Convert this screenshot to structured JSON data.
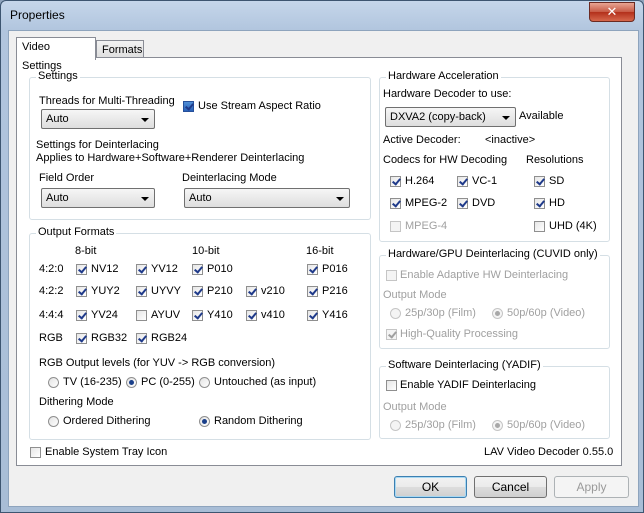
{
  "window": {
    "title": "Properties",
    "close_glyph": "✕"
  },
  "tabs": [
    {
      "label": "Video Settings"
    },
    {
      "label": "Formats"
    }
  ],
  "settings": {
    "group_label": "Settings",
    "threads_label": "Threads for Multi-Threading",
    "threads_value": "Auto",
    "stream_aspect_label": "Use Stream Aspect Ratio",
    "deint_settings_label": "Settings for Deinterlacing",
    "deint_applies_label": "Applies to Hardware+Software+Renderer Deinterlacing",
    "field_order_label": "Field Order",
    "field_order_value": "Auto",
    "deint_mode_label": "Deinterlacing Mode",
    "deint_mode_value": "Auto"
  },
  "output_formats": {
    "group_label": "Output Formats",
    "col_8bit": "8-bit",
    "col_10bit": "10-bit",
    "col_16bit": "16-bit",
    "rows": {
      "r420": "4:2:0",
      "r422": "4:2:2",
      "r444": "4:4:4",
      "rgb": "RGB"
    },
    "nv12": "NV12",
    "yv12": "YV12",
    "p010": "P010",
    "p016": "P016",
    "yuy2": "YUY2",
    "uyvy": "UYVY",
    "p210": "P210",
    "v210": "v210",
    "p216": "P216",
    "yv24": "YV24",
    "ayuv": "AYUV",
    "y410": "Y410",
    "v410": "v410",
    "y416": "Y416",
    "rgb32": "RGB32",
    "rgb24": "RGB24",
    "levels_label": "RGB Output levels (for YUV -> RGB conversion)",
    "tv_label": "TV (16-235)",
    "pc_label": "PC (0-255)",
    "untouched_label": "Untouched (as input)",
    "dither_label": "Dithering Mode",
    "ordered_label": "Ordered Dithering",
    "random_label": "Random Dithering"
  },
  "hw_accel": {
    "group_label": "Hardware Acceleration",
    "decoder_label": "Hardware Decoder to use:",
    "decoder_value": "DXVA2 (copy-back)",
    "available_label": "Available",
    "active_label": "Active Decoder:",
    "active_value": "<inactive>",
    "codecs_label": "Codecs for HW Decoding",
    "resolutions_label": "Resolutions",
    "h264": "H.264",
    "vc1": "VC-1",
    "sd": "SD",
    "mpeg2": "MPEG-2",
    "dvd": "DVD",
    "hd": "HD",
    "mpeg4": "MPEG-4",
    "uhd": "UHD (4K)"
  },
  "gpu_deint": {
    "group_label": "Hardware/GPU Deinterlacing (CUVID only)",
    "enable_label": "Enable Adaptive HW Deinterlacing",
    "output_mode_label": "Output Mode",
    "film_label": "25p/30p (Film)",
    "video_label": "50p/60p (Video)",
    "hq_label": "High-Quality Processing"
  },
  "sw_deint": {
    "group_label": "Software Deinterlacing (YADIF)",
    "enable_label": "Enable YADIF Deinterlacing",
    "output_mode_label": "Output Mode",
    "film_label": "25p/30p (Film)",
    "video_label": "50p/60p (Video)"
  },
  "footer": {
    "tray_label": "Enable System Tray Icon",
    "version_label": "LAV Video Decoder 0.55.0",
    "ok_label": "OK",
    "cancel_label": "Cancel",
    "apply_label": "Apply"
  }
}
